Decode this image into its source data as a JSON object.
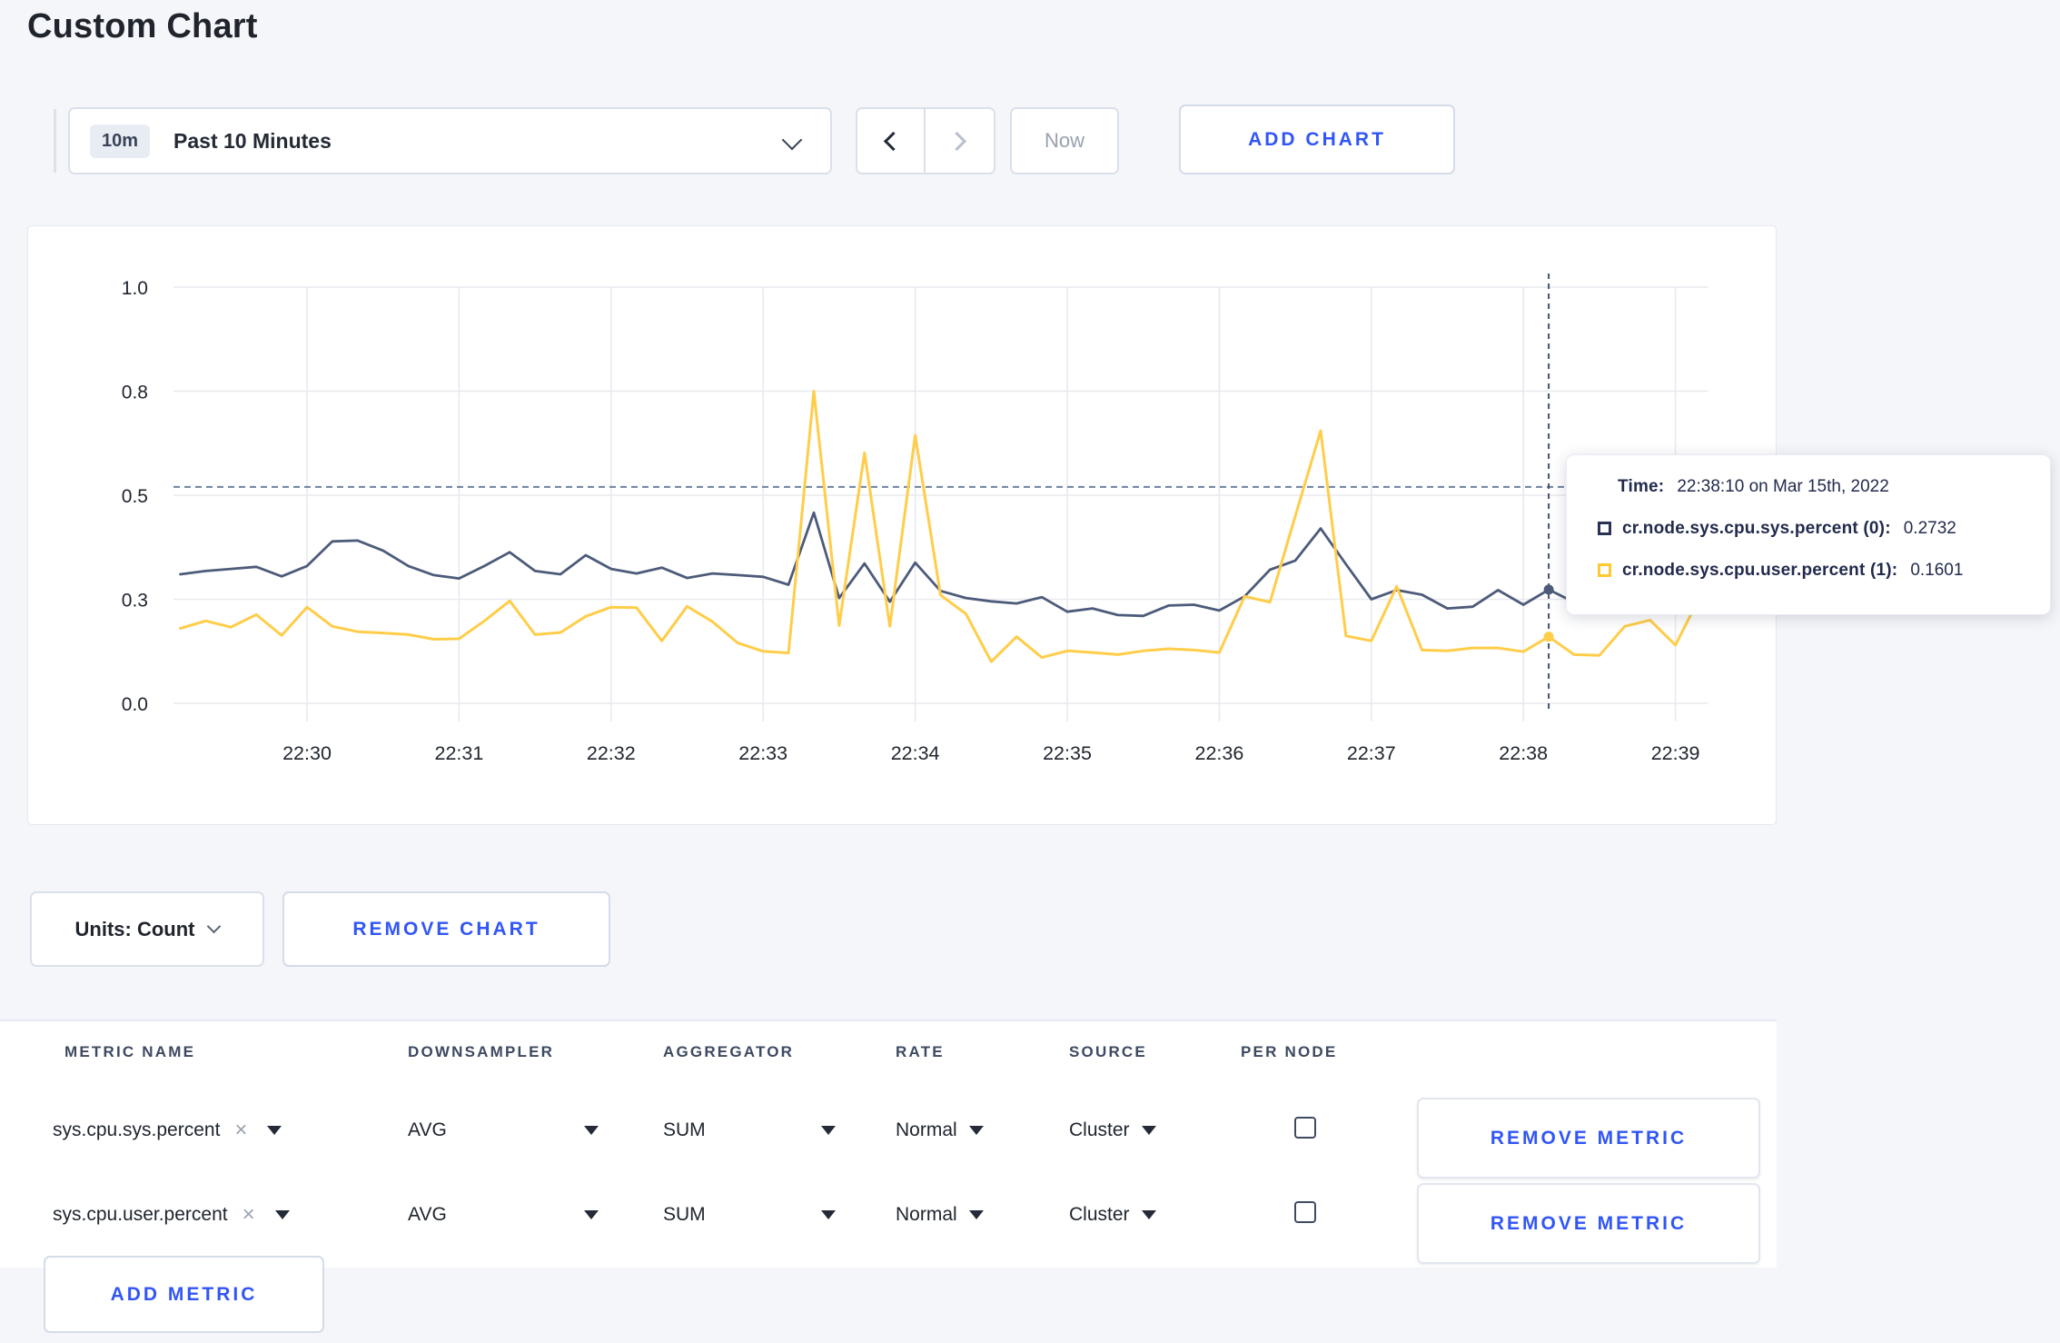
{
  "page": {
    "title": "Custom Chart"
  },
  "toolbar": {
    "range_badge": "10m",
    "range_label": "Past 10 Minutes",
    "now_label": "Now",
    "add_chart_label": "ADD CHART"
  },
  "icons": {
    "close_char": "×"
  },
  "tooltip": {
    "time_label": "Time:",
    "time_value": "22:38:10 on Mar 15th, 2022",
    "series": [
      {
        "label": "cr.node.sys.cpu.sys.percent (0):",
        "value": "0.2732",
        "color": "#2a3354"
      },
      {
        "label": "cr.node.sys.cpu.user.percent (1):",
        "value": "0.1601",
        "color": "#ffc930"
      }
    ]
  },
  "chart_footer": {
    "units_label": "Units: Count",
    "remove_chart_label": "REMOVE CHART"
  },
  "metrics_table": {
    "headers": [
      "METRIC NAME",
      "DOWNSAMPLER",
      "AGGREGATOR",
      "RATE",
      "SOURCE",
      "PER NODE"
    ],
    "rows": [
      {
        "metric": "sys.cpu.sys.percent",
        "downsampler": "AVG",
        "aggregator": "SUM",
        "rate": "Normal",
        "source": "Cluster",
        "per_node_checked": false,
        "remove_label": "REMOVE METRIC"
      },
      {
        "metric": "sys.cpu.user.percent",
        "downsampler": "AVG",
        "aggregator": "SUM",
        "rate": "Normal",
        "source": "Cluster",
        "per_node_checked": false,
        "remove_label": "REMOVE METRIC"
      }
    ],
    "add_metric_label": "ADD METRIC"
  },
  "chart_data": {
    "type": "line",
    "title": "",
    "xlabel": "",
    "ylabel": "",
    "ylim": [
      0,
      1
    ],
    "grid": true,
    "legend_position": "tooltip",
    "x_start_time": "22:29:10",
    "x_interval_seconds": 10,
    "x_ticks": [
      "22:30",
      "22:31",
      "22:32",
      "22:33",
      "22:34",
      "22:35",
      "22:36",
      "22:37",
      "22:38",
      "22:39"
    ],
    "y_ticks": [
      {
        "v": 0.0,
        "label": "0.0"
      },
      {
        "v": 0.25,
        "label": "0.3"
      },
      {
        "v": 0.5,
        "label": "0.5"
      },
      {
        "v": 0.75,
        "label": "0.8"
      },
      {
        "v": 1.0,
        "label": "1.0"
      }
    ],
    "crosshair": {
      "time": "22:38:10",
      "hline_value": 0.52,
      "dot_values": [
        0.2732,
        0.1601
      ]
    },
    "series": [
      {
        "name": "cr.node.sys.cpu.sys.percent",
        "color": "#4d5b7a",
        "width": 2.8,
        "values": [
          0.31,
          0.318,
          0.323,
          0.328,
          0.305,
          0.33,
          0.389,
          0.391,
          0.367,
          0.33,
          0.308,
          0.3,
          0.33,
          0.363,
          0.318,
          0.31,
          0.356,
          0.323,
          0.312,
          0.326,
          0.301,
          0.312,
          0.308,
          0.304,
          0.285,
          0.458,
          0.253,
          0.336,
          0.244,
          0.338,
          0.27,
          0.253,
          0.245,
          0.24,
          0.255,
          0.22,
          0.228,
          0.212,
          0.21,
          0.235,
          0.237,
          0.223,
          0.257,
          0.321,
          0.343,
          0.42,
          0.334,
          0.25,
          0.272,
          0.261,
          0.228,
          0.232,
          0.272,
          0.237,
          0.2732,
          0.243,
          0.265,
          0.29,
          0.305,
          0.3,
          0.31
        ]
      },
      {
        "name": "cr.node.sys.cpu.user.percent",
        "color": "#ffcd49",
        "width": 3,
        "values": [
          0.18,
          0.198,
          0.183,
          0.213,
          0.163,
          0.231,
          0.185,
          0.172,
          0.169,
          0.165,
          0.154,
          0.155,
          0.198,
          0.246,
          0.165,
          0.17,
          0.209,
          0.231,
          0.23,
          0.15,
          0.233,
          0.196,
          0.145,
          0.125,
          0.121,
          0.75,
          0.187,
          0.602,
          0.185,
          0.644,
          0.26,
          0.215,
          0.1,
          0.16,
          0.11,
          0.126,
          0.122,
          0.117,
          0.126,
          0.131,
          0.128,
          0.122,
          0.257,
          0.243,
          0.45,
          0.655,
          0.162,
          0.15,
          0.281,
          0.128,
          0.126,
          0.133,
          0.133,
          0.124,
          0.1601,
          0.117,
          0.115,
          0.185,
          0.2,
          0.14,
          0.26
        ]
      }
    ]
  }
}
